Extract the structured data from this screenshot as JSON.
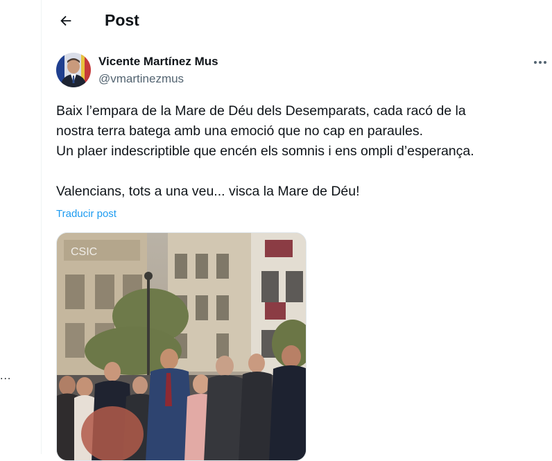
{
  "header": {
    "title": "Post"
  },
  "left_sidebar": {
    "more_glyph": "..."
  },
  "tweet": {
    "author_name": "Vicente Martínez Mus",
    "author_handle": "@vmartinezmus",
    "text_lines": [
      "Baix l’empara de la Mare de Déu dels Desemparats, cada racó de la",
      "nostra terra batega amb una emoció que no cap en paraules.",
      "Un plaer indescriptible que encén els somnis i ens ompli d’esperança.",
      "",
      "Valencians, tots a una veu... visca la Mare de Déu!"
    ],
    "translate_label": "Traducir post",
    "media": {
      "sign_text": "CSIC"
    }
  },
  "colors": {
    "link": "#1d9bf0",
    "secondary_text": "#536471",
    "divider": "#eff3f4"
  },
  "icons": {
    "back": "back-arrow-icon",
    "more": "more-horizontal-icon"
  }
}
